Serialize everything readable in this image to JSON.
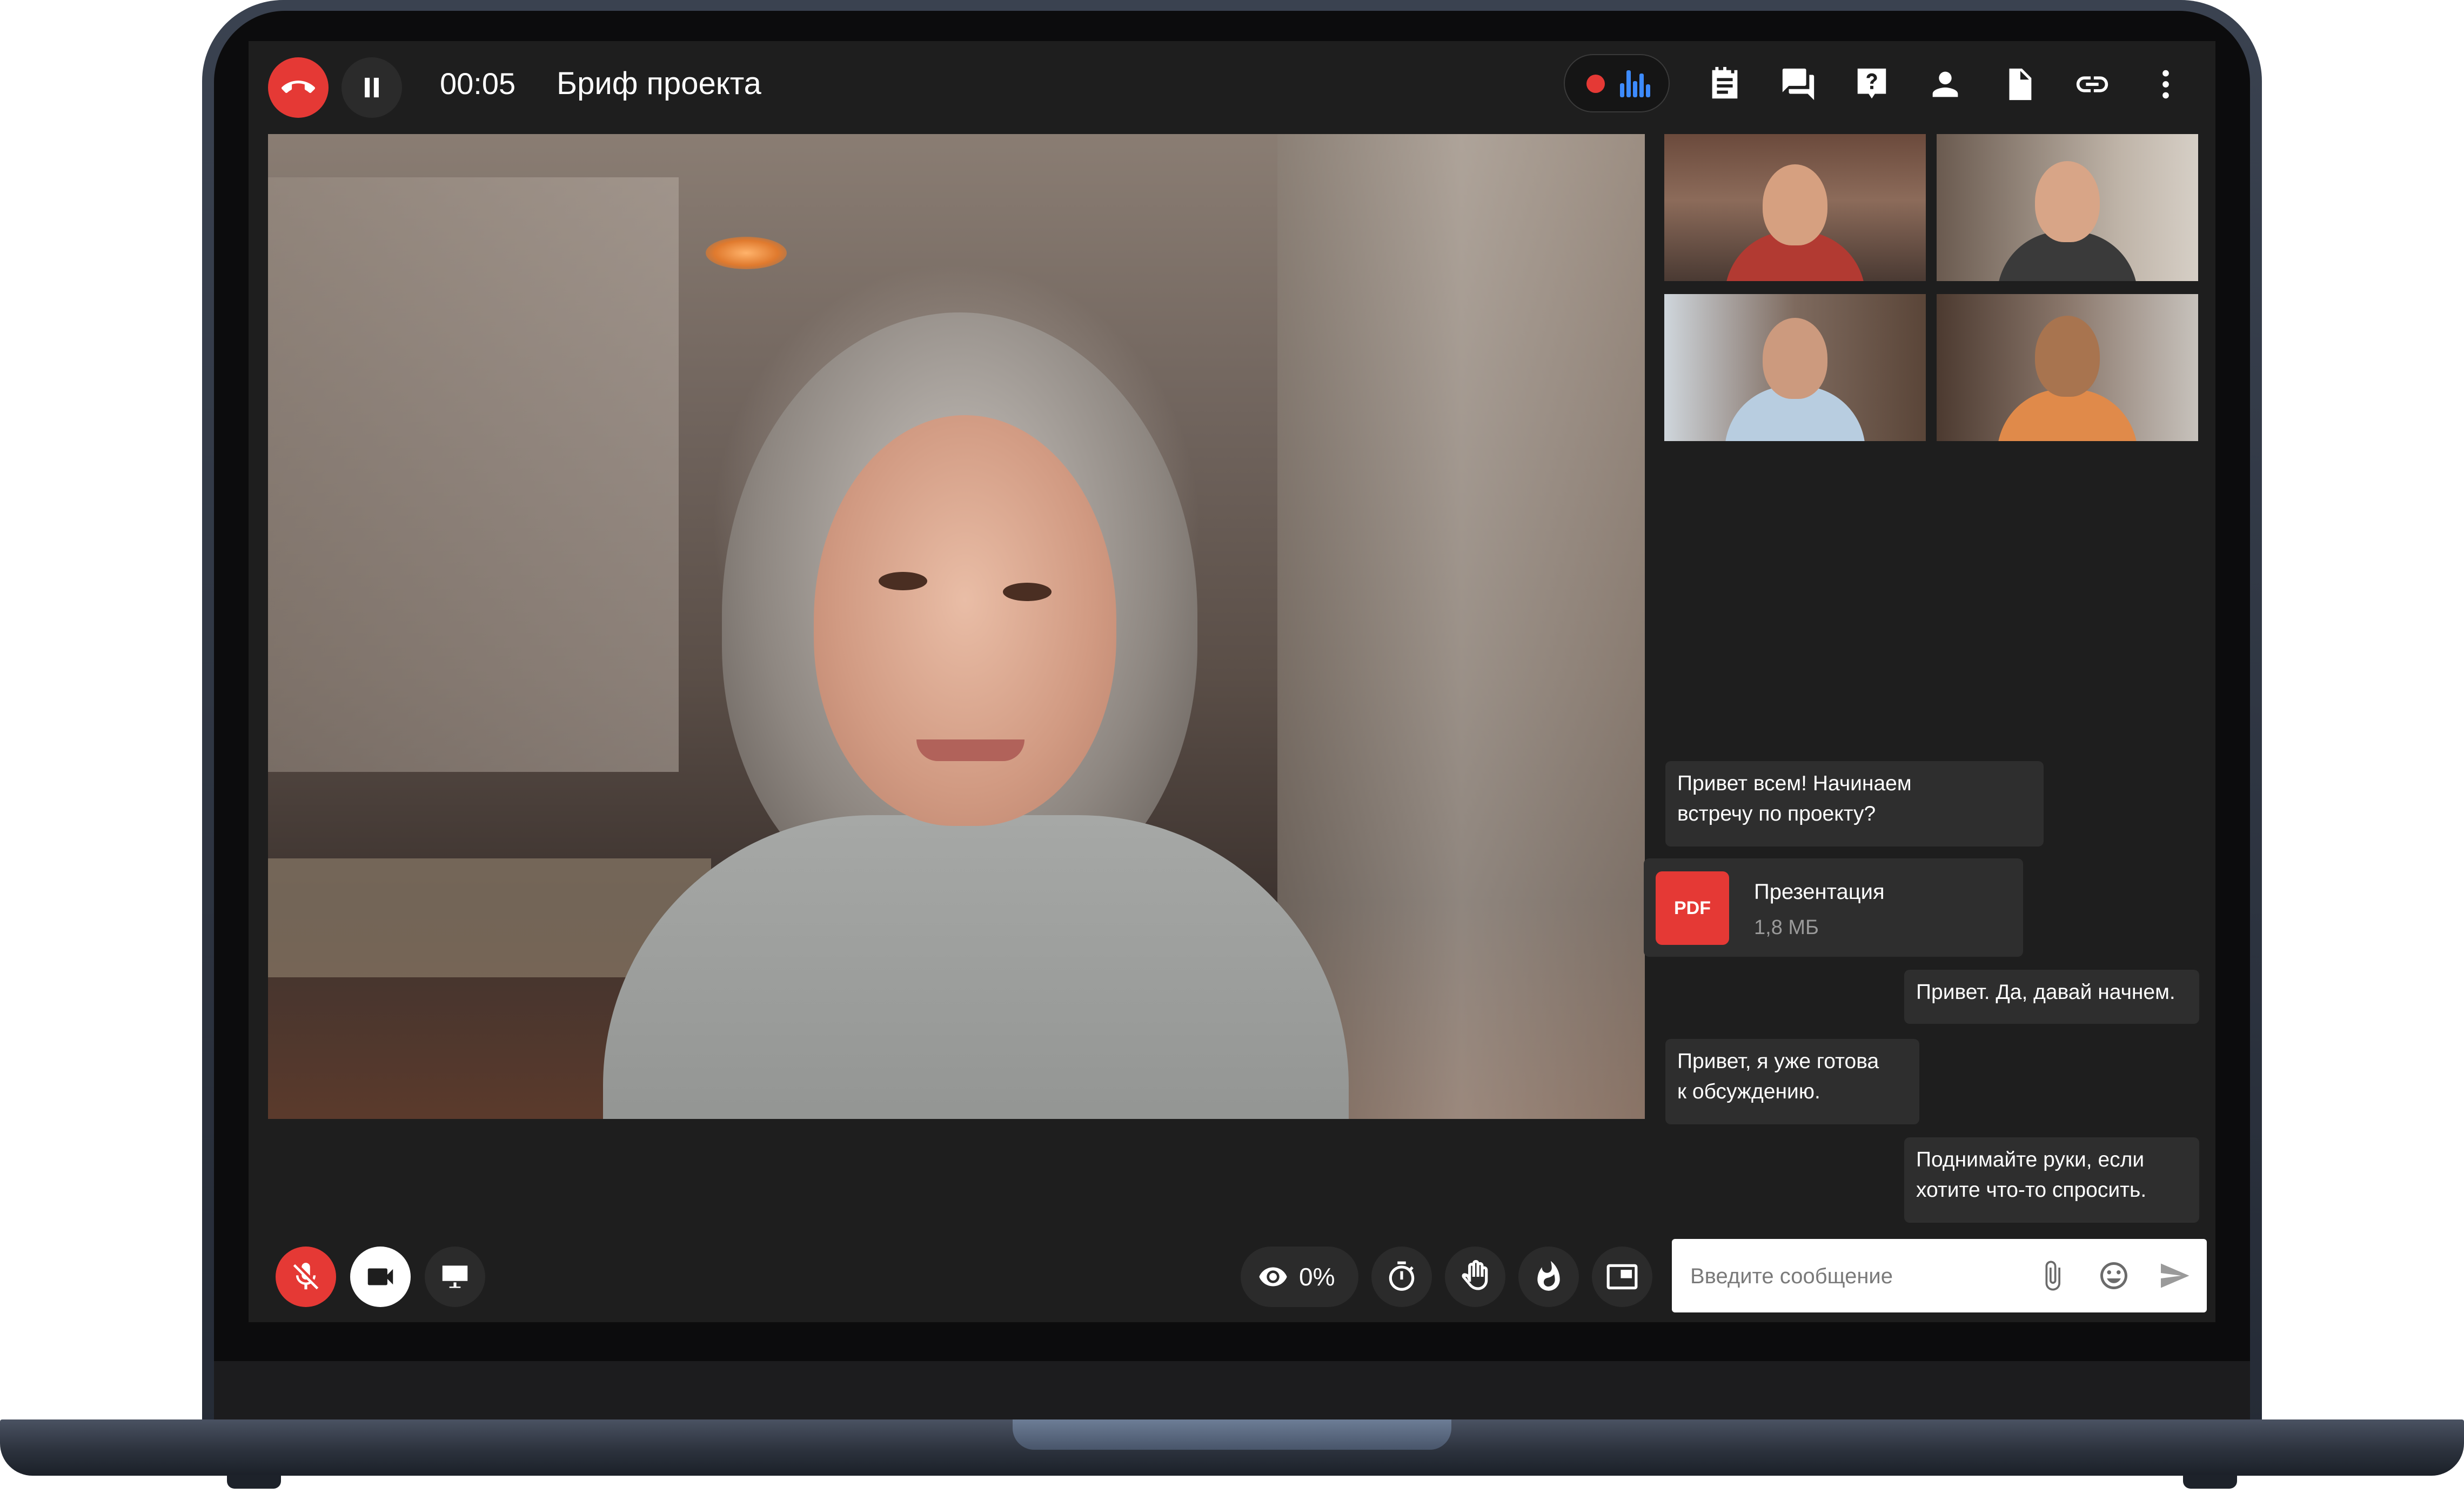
{
  "call": {
    "timer": "00:05",
    "title": "Бриф проекта"
  },
  "header_icons": [
    "end-call-icon",
    "pause-icon",
    "record-dot-icon",
    "audio-bars-icon",
    "notes-icon",
    "chat-icon",
    "question-icon",
    "participants-icon",
    "document-icon",
    "link-icon",
    "more-icon"
  ],
  "chat": {
    "messages": [
      {
        "text": "Привет всем! Начинаем\nвстречу по проекту?",
        "side": "left"
      },
      {
        "text": "Привет. Да, давай начнем.",
        "side": "right"
      },
      {
        "text": "Привет, я уже готова\nк обсуждению.",
        "side": "left"
      },
      {
        "text": "Поднимайте руки, если\nхотите что-то спросить.",
        "side": "right"
      }
    ],
    "file": {
      "badge": "PDF",
      "name": "Презентация",
      "size": "1,8 МБ"
    },
    "input_placeholder": "Введите сообщение"
  },
  "controls": {
    "views_percent": "0%",
    "left_icons": [
      "mic-off-icon",
      "camera-icon",
      "screen-share-icon"
    ],
    "right_icons": [
      "eye-icon",
      "stopwatch-icon",
      "raise-hand-icon",
      "fire-icon",
      "pip-icon"
    ]
  },
  "colors": {
    "accent_red": "#e53935",
    "screen_bg": "#1e1e1e",
    "bubble_bg": "#2e2e2e",
    "audio_blue": "#3d8bff"
  }
}
